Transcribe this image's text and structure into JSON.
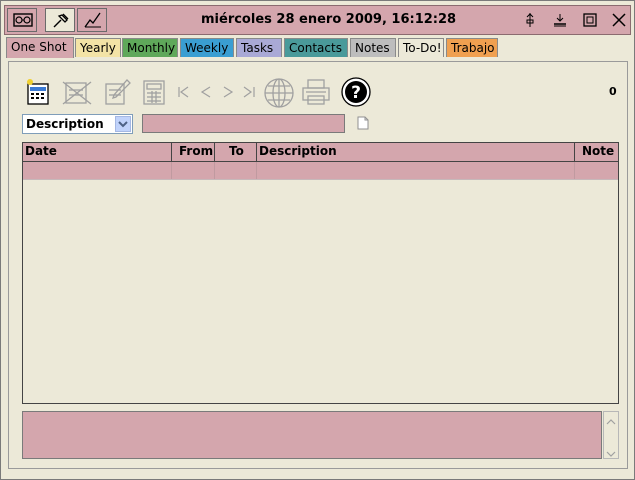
{
  "window": {
    "title": "miércoles 28 enero 2009,  16:12:28",
    "left_buttons": [
      "glasses-icon",
      "pin-icon",
      "chart-line-icon"
    ],
    "controls": [
      "pin-down-icon",
      "minimize-icon",
      "maximize-icon",
      "close-icon"
    ]
  },
  "tabs": [
    {
      "label": "One Shot",
      "color": "#d4a6ad",
      "active": true
    },
    {
      "label": "Yearly",
      "color": "#f3e3a6"
    },
    {
      "label": "Monthly",
      "color": "#5fa85a"
    },
    {
      "label": "Weekly",
      "color": "#3a9ed2"
    },
    {
      "label": "Tasks",
      "color": "#a9a9d6"
    },
    {
      "label": "Contacts",
      "color": "#4a9a9a"
    },
    {
      "label": "Notes",
      "color": "#bdbdbd"
    },
    {
      "label": "To-Do!",
      "color": "#ece9d8"
    },
    {
      "label": "Trabajo",
      "color": "#f0a050"
    }
  ],
  "toolbar": {
    "icons": [
      "new-entry-icon",
      "delete-icon",
      "edit-icon",
      "calculator-icon",
      "first-icon",
      "previous-icon",
      "next-icon",
      "last-icon",
      "globe-icon",
      "print-icon",
      "help-icon"
    ],
    "count": "0"
  },
  "search": {
    "field_selected": "Description",
    "value": ""
  },
  "table": {
    "columns": [
      "Date",
      "From",
      "To",
      "Description",
      "Note"
    ],
    "rows": [
      [
        "",
        "",
        "",
        "",
        ""
      ]
    ]
  },
  "note": {
    "value": ""
  }
}
